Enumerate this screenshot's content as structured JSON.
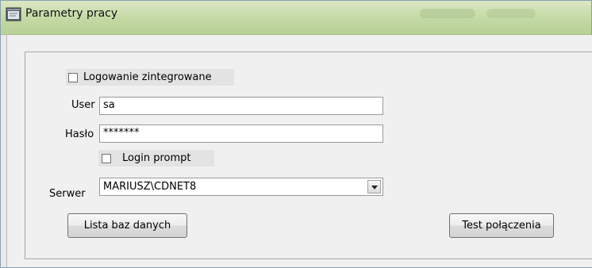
{
  "window": {
    "title": "Parametry pracy",
    "title_bar_color": "#c3d9a4",
    "app_icon": "window-form-icon"
  },
  "form": {
    "integrated_login_label": "Logowanie zintegrowane",
    "integrated_login_checked": false,
    "user_label": "User",
    "user_value": "sa",
    "password_label": "Hasło",
    "password_value": "*******",
    "login_prompt_label": "Login prompt",
    "login_prompt_checked": false,
    "server_label": "Serwer",
    "server_value": "MARIUSZ\\CDNET8",
    "dropdown_icon": "chevron-down-icon"
  },
  "buttons": {
    "database_list_label": "Lista baz danych",
    "test_connection_label": "Test połączenia"
  }
}
